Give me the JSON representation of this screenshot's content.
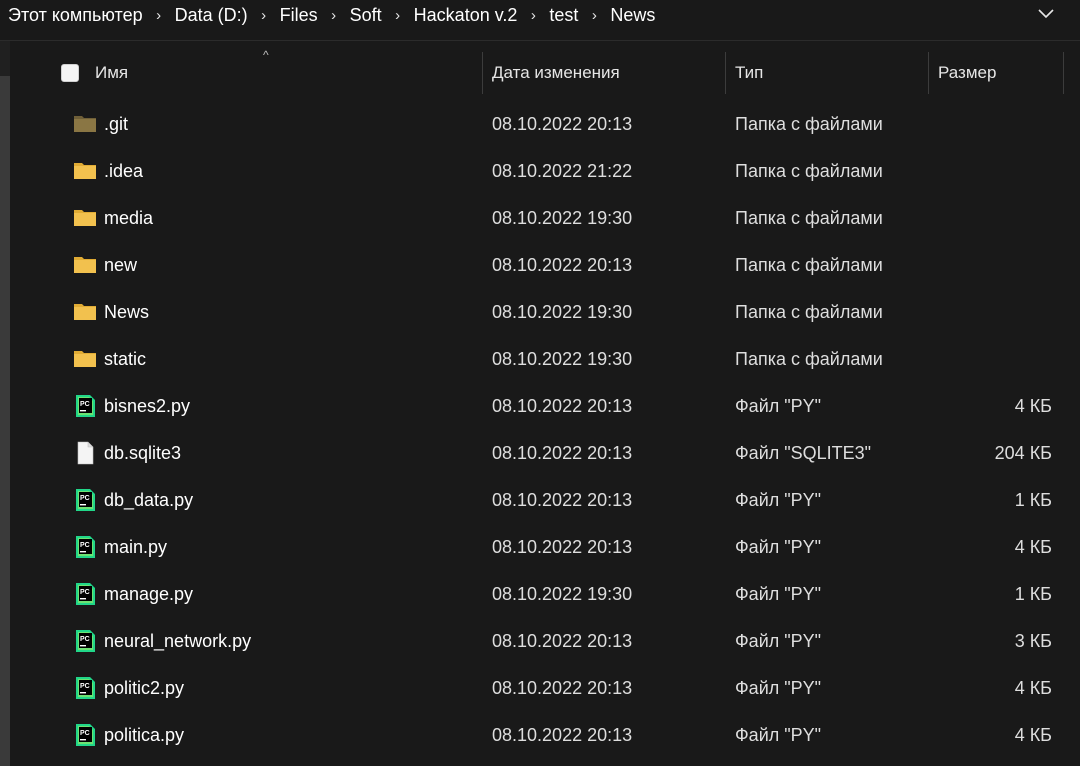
{
  "breadcrumb": [
    "Этот компьютер",
    "Data (D:)",
    "Files",
    "Soft",
    "Hackaton v.2",
    "test",
    "News"
  ],
  "columns": {
    "name": "Имя",
    "date": "Дата изменения",
    "type": "Тип",
    "size": "Размер"
  },
  "files": [
    {
      "name": ".git",
      "date": "08.10.2022 20:13",
      "type": "Папка с файлами",
      "size": "",
      "icon": "folder-dim-icon"
    },
    {
      "name": ".idea",
      "date": "08.10.2022 21:22",
      "type": "Папка с файлами",
      "size": "",
      "icon": "folder-icon"
    },
    {
      "name": "media",
      "date": "08.10.2022 19:30",
      "type": "Папка с файлами",
      "size": "",
      "icon": "folder-icon"
    },
    {
      "name": "new",
      "date": "08.10.2022 20:13",
      "type": "Папка с файлами",
      "size": "",
      "icon": "folder-icon"
    },
    {
      "name": "News",
      "date": "08.10.2022 19:30",
      "type": "Папка с файлами",
      "size": "",
      "icon": "folder-icon"
    },
    {
      "name": "static",
      "date": "08.10.2022 19:30",
      "type": "Папка с файлами",
      "size": "",
      "icon": "folder-icon"
    },
    {
      "name": "bisnes2.py",
      "date": "08.10.2022 20:13",
      "type": "Файл \"PY\"",
      "size": "4 КБ",
      "icon": "pycharm-file-icon"
    },
    {
      "name": "db.sqlite3",
      "date": "08.10.2022 20:13",
      "type": "Файл \"SQLITE3\"",
      "size": "204 КБ",
      "icon": "blank-file-icon"
    },
    {
      "name": "db_data.py",
      "date": "08.10.2022 20:13",
      "type": "Файл \"PY\"",
      "size": "1 КБ",
      "icon": "pycharm-file-icon"
    },
    {
      "name": "main.py",
      "date": "08.10.2022 20:13",
      "type": "Файл \"PY\"",
      "size": "4 КБ",
      "icon": "pycharm-file-icon"
    },
    {
      "name": "manage.py",
      "date": "08.10.2022 19:30",
      "type": "Файл \"PY\"",
      "size": "1 КБ",
      "icon": "pycharm-file-icon"
    },
    {
      "name": "neural_network.py",
      "date": "08.10.2022 20:13",
      "type": "Файл \"PY\"",
      "size": "3 КБ",
      "icon": "pycharm-file-icon"
    },
    {
      "name": "politic2.py",
      "date": "08.10.2022 20:13",
      "type": "Файл \"PY\"",
      "size": "4 КБ",
      "icon": "pycharm-file-icon"
    },
    {
      "name": "politica.py",
      "date": "08.10.2022 20:13",
      "type": "Файл \"PY\"",
      "size": "4 КБ",
      "icon": "pycharm-file-icon"
    }
  ],
  "colors": {
    "background": "#191919",
    "folder": "#f2c14e",
    "pycharm_green": "#21d789",
    "pycharm_dark": "#000000"
  }
}
